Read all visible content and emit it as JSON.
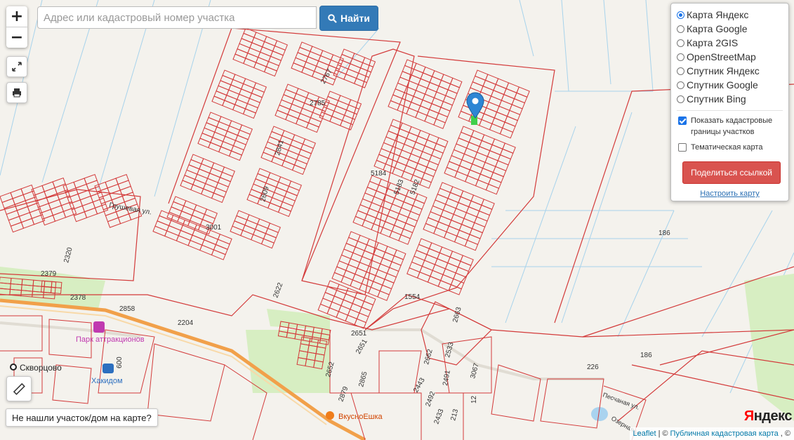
{
  "search": {
    "placeholder": "Адрес или кадастровый номер участка",
    "button_label": "Найти"
  },
  "zoom": {
    "in": "+",
    "out": "−"
  },
  "layers": {
    "options": [
      {
        "label": "Карта Яндекс",
        "selected": true
      },
      {
        "label": "Карта Google",
        "selected": false
      },
      {
        "label": "Карта 2GIS",
        "selected": false
      },
      {
        "label": "OpenStreetMap",
        "selected": false
      },
      {
        "label": "Спутник Яндекс",
        "selected": false
      },
      {
        "label": "Спутник Google",
        "selected": false
      },
      {
        "label": "Спутник Bing",
        "selected": false
      }
    ],
    "show_borders_label": "Показать кадастровые границы участков",
    "show_borders_checked": true,
    "thematic_label": "Тематическая карта",
    "thematic_checked": false,
    "share_label": "Поделиться ссылкой",
    "settings_label": "Настроить карту"
  },
  "not_found_label": "Не нашли участок/дом на карте?",
  "attribution": {
    "leaflet": "Leaflet",
    "sep": "|",
    "copy": "©",
    "pkk": "Публичная кадастровая карта",
    "tail": ", ©"
  },
  "logo": {
    "first_letter": "Я",
    "rest": "ндекс"
  },
  "map": {
    "parcel_labels": [
      "2767",
      "2785",
      "2841",
      "5184",
      "5183",
      "5182",
      "2609",
      "3001",
      "2320",
      "2379",
      "2378",
      "2858",
      "2204",
      "2622",
      "1554",
      "2663",
      "2651",
      "2651",
      "2652",
      "2865",
      "2879",
      "2533",
      "2662",
      "2491",
      "3067",
      "2443",
      "2492",
      "2433",
      "213",
      "12",
      "186",
      "186",
      "226",
      "600"
    ],
    "street_labels": [
      "Грушевая ул.",
      "Песчаная ул.",
      "Озерная ул."
    ],
    "places": [
      "Парк аттракционов",
      "Хакидом",
      "ВкусноЕшка",
      "Скворцово"
    ],
    "colors": {
      "parcel": "#d33a3a",
      "road": "#f1a04a",
      "green": "#d7eec2",
      "water": "#a9d3ef",
      "land": "#f3f1ec",
      "field_line": "#a7d3ec"
    }
  }
}
